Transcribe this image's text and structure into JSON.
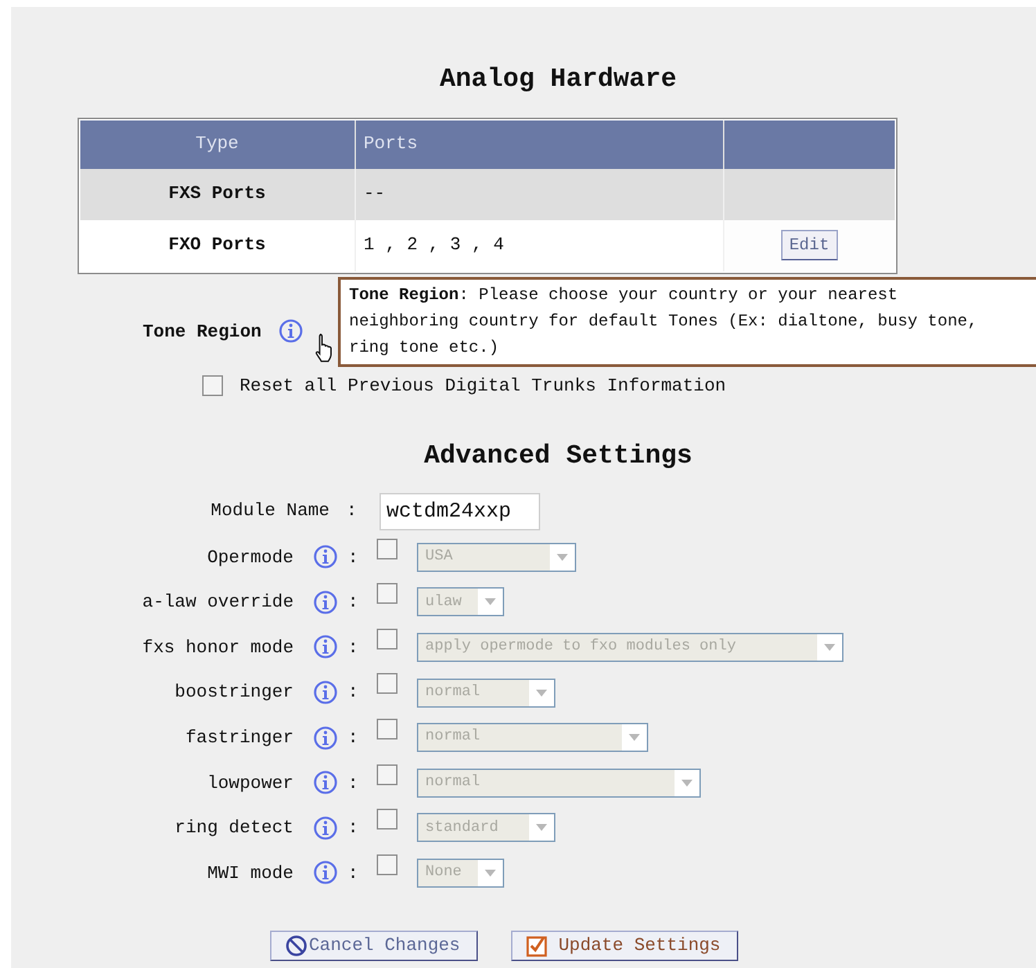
{
  "title": "Analog Hardware",
  "table": {
    "columns": [
      "Type",
      "Ports"
    ],
    "rows": [
      {
        "type": "FXS Ports",
        "ports": "--"
      },
      {
        "type": "FXO Ports",
        "ports": "1 , 2 , 3 , 4",
        "action": "Edit"
      }
    ]
  },
  "tone_region": {
    "label": "Tone Region"
  },
  "tooltip": "**Tone Region**: Please choose your country or your nearest neighboring country for default Tones (Ex: dialtone, busy tone, ring tone etc.)",
  "reset": {
    "label": "Reset all Previous Digital Trunks Information",
    "checked": false
  },
  "advanced_title": "Advanced Settings",
  "module_name": {
    "label": "Module Name",
    "separator": ":",
    "value": "wctdm24xxp"
  },
  "options": [
    {
      "label": "Opermode",
      "separator": ":",
      "checked": false,
      "value": "USA",
      "disabled": true
    },
    {
      "label": "a-law override",
      "separator": ":",
      "checked": false,
      "value": "ulaw",
      "disabled": true
    },
    {
      "label": "fxs honor mode",
      "separator": ":",
      "checked": false,
      "value": "apply opermode to fxo modules only",
      "disabled": true
    },
    {
      "label": "boostringer",
      "separator": ":",
      "checked": false,
      "value": "normal",
      "disabled": true
    },
    {
      "label": "fastringer",
      "separator": ":",
      "checked": false,
      "value": "normal",
      "disabled": true
    },
    {
      "label": "lowpower",
      "separator": ":",
      "checked": false,
      "value": "normal",
      "disabled": true
    },
    {
      "label": "ring detect",
      "separator": ":",
      "checked": false,
      "value": "standard",
      "disabled": true
    },
    {
      "label": "MWI mode",
      "separator": ":",
      "checked": false,
      "value": "None",
      "disabled": true
    }
  ],
  "buttons": [
    {
      "kind": "cancel",
      "label": "Cancel Changes"
    },
    {
      "kind": "update",
      "label": "Update Settings"
    }
  ]
}
